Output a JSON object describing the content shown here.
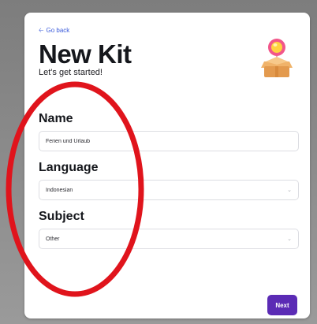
{
  "back_link": {
    "label": "Go back",
    "icon": "arrow-left-icon"
  },
  "header": {
    "title": "New Kit",
    "subtitle": "Let's get started!",
    "illustration": "gift-box-balloon-icon"
  },
  "form": {
    "name": {
      "label": "Name",
      "value": "Ferien und Urlaub"
    },
    "language": {
      "label": "Language",
      "value": "Indonesian"
    },
    "subject": {
      "label": "Subject",
      "value": "Other"
    }
  },
  "actions": {
    "next_label": "Next"
  },
  "colors": {
    "accent": "#5b2bb5",
    "link": "#3b5bdb",
    "annotation": "#e0141c"
  }
}
